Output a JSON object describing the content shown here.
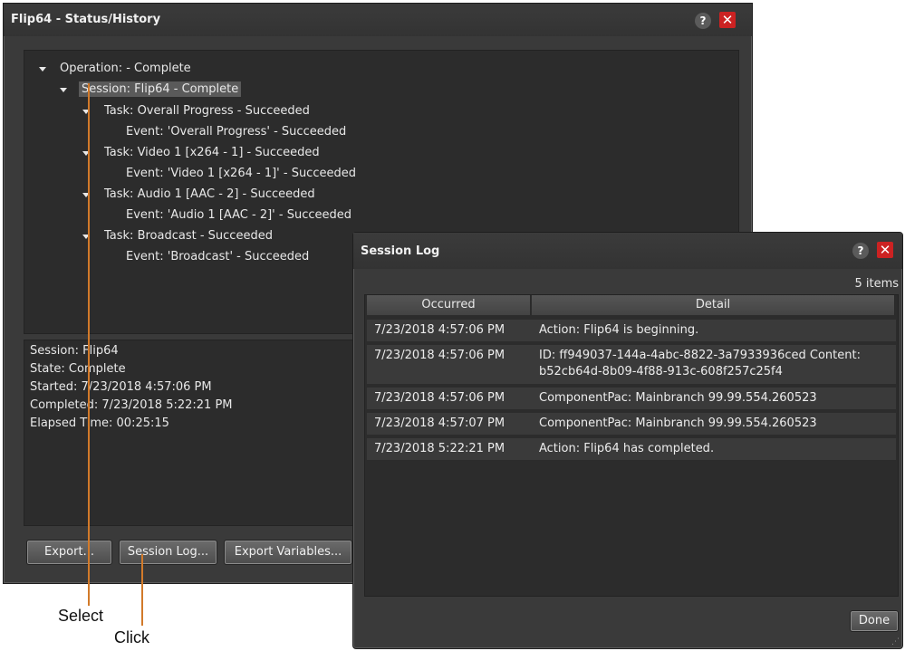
{
  "status_window": {
    "title": "Flip64 - Status/History",
    "help": "?",
    "close": "✕",
    "tree": {
      "operation": "Operation: - Complete",
      "session": "Session: Flip64 - Complete",
      "tasks": [
        {
          "task": "Task: Overall Progress - Succeeded",
          "event": "Event: 'Overall Progress' - Succeeded"
        },
        {
          "task": "Task: Video 1 [x264 - 1] - Succeeded",
          "event": "Event: 'Video 1 [x264 - 1]' - Succeeded"
        },
        {
          "task": "Task: Audio 1 [AAC - 2] - Succeeded",
          "event": "Event: 'Audio 1 [AAC - 2]' - Succeeded"
        },
        {
          "task": "Task: Broadcast - Succeeded",
          "event": "Event: 'Broadcast' - Succeeded"
        }
      ]
    },
    "info": [
      "Session: Flip64",
      "State: Complete",
      "Started: 7/23/2018 4:57:06 PM",
      "Completed: 7/23/2018 5:22:21 PM",
      "Elapsed Time: 00:25:15"
    ],
    "buttons": {
      "export": "Export...",
      "session_log": "Session Log...",
      "export_variables": "Export Variables..."
    }
  },
  "session_log": {
    "title": "Session Log",
    "help": "?",
    "close": "✕",
    "count": "5 items",
    "columns": [
      "Occurred",
      "Detail"
    ],
    "rows": [
      {
        "occurred": "7/23/2018 4:57:06 PM",
        "detail": [
          "Action: Flip64 is beginning."
        ]
      },
      {
        "occurred": "7/23/2018 4:57:06 PM",
        "detail": [
          "ID: ff949037-144a-4abc-8822-3a7933936ced  Content:",
          "b52cb64d-8b09-4f88-913c-608f257c25f4"
        ]
      },
      {
        "occurred": "7/23/2018 4:57:06 PM",
        "detail": [
          "ComponentPac: Mainbranch 99.99.554.260523"
        ]
      },
      {
        "occurred": "7/23/2018 4:57:07 PM",
        "detail": [
          "ComponentPac: Mainbranch 99.99.554.260523"
        ]
      },
      {
        "occurred": "7/23/2018 5:22:21 PM",
        "detail": [
          "Action: Flip64 has completed."
        ]
      }
    ],
    "done": "Done"
  },
  "callouts": {
    "select": "Select",
    "click": "Click",
    "color": "#d27a2a"
  }
}
